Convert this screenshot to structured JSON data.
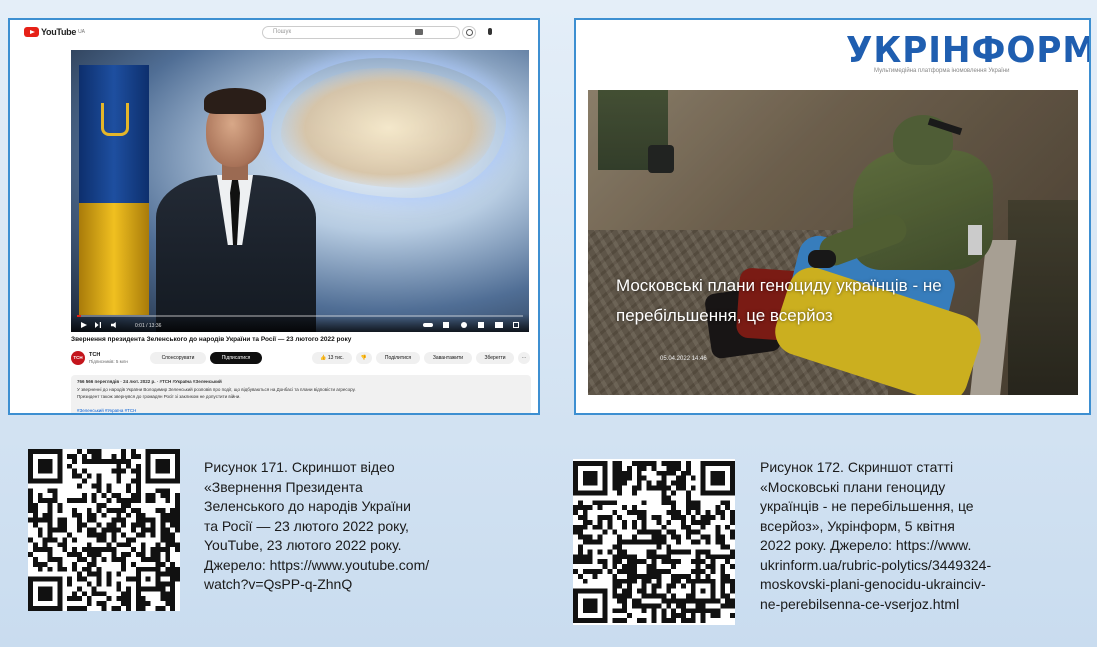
{
  "youtube": {
    "logo_text": "YouTube",
    "logo_sup": "UA",
    "search_placeholder": "Пошук",
    "player_time": "0:01 / 13:36",
    "video_title": "Звернення президента Зеленського до народів України та Росії — 23 лютого 2022 року",
    "channel_name": "ТСН",
    "channel_avatar": "ТСН",
    "channel_subs": "Підписників: 5 млн",
    "btn_join": "Спонсорувати",
    "btn_subscribe": "Підписатися",
    "likes": "13 тис.",
    "btn_share": "Поділитися",
    "btn_download": "Завантажити",
    "btn_save": "Зберегти",
    "progress_fraction": 0.01,
    "desc_meta": "766 566 переглядів · 24 лют. 2022 р. · #ТСН #Україна #Зеленський",
    "desc_line1": "У зверненні до народів України Володимир Зеленський розповів про події, що відбуваються на Донбасі та плани відповісти агресору.",
    "desc_line2": "Президент також звернувся до громадян Росії зі закликом не допустити війни.",
    "desc_hashtag": "#Зеленський #Україна #ТСН"
  },
  "ukrinform": {
    "logo": "УКРІНФОРМ",
    "slogan": "Мультимедійна платформа іномовлення України",
    "headline_line1": "Московські плани геноциду українців - не",
    "headline_line2": "перебільшення, це всерйоз",
    "date": "05.04.2022 14:46"
  },
  "captions": {
    "fig171": [
      "Рисунок 171. Скриншот відео",
      "«Звернення Президента",
      "Зеленського до народів України",
      "та Росії — 23 лютого 2022 року,",
      "YouTube, 23 лютого 2022 року.",
      "Джерело: https://www.youtube.com/",
      "watch?v=QsPP-q-ZhnQ"
    ],
    "fig172": [
      "Рисунок 172. Скриншот статті",
      "«Московські плани геноциду",
      "українців - не перебільшення, це",
      "всерйоз», Укрінформ, 5 квітня",
      "2022 року. Джерело: https://www.",
      "ukrinform.ua/rubric-polytics/3449324-",
      "moskovski-plani-genocidu-ukrainciv-",
      "ne-perebilsenna-ce-vserjoz.html"
    ]
  },
  "colors": {
    "frame_border": "#3d8fd1",
    "youtube_red": "#e62117",
    "ukrinform_blue": "#1f5eb0",
    "qr_dark": "#111111"
  },
  "icons": [
    "youtube-logo-icon",
    "search-icon",
    "mic-icon",
    "play-icon",
    "like-icon",
    "qr-code-icon"
  ]
}
